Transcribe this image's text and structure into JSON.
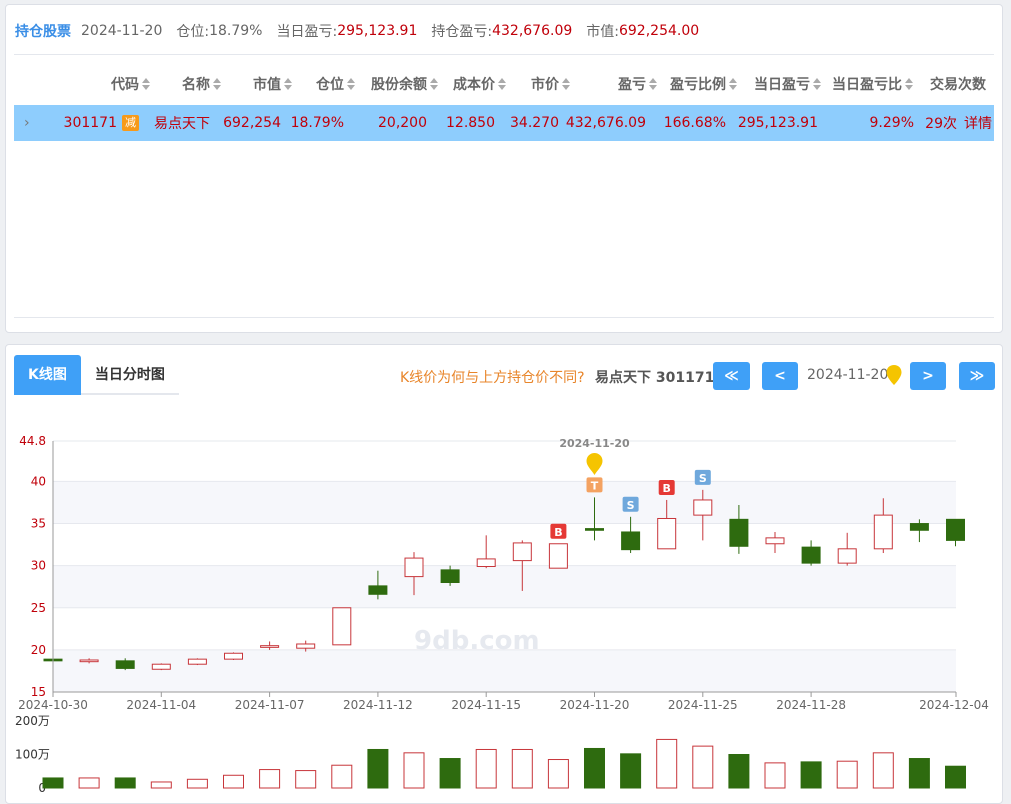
{
  "holdings": {
    "title": "持仓股票",
    "date": "2024-11-20",
    "position_label": "仓位:",
    "position_value": "18.79%",
    "daily_pl_label": "当日盈亏:",
    "daily_pl_value": "295,123.91",
    "hold_pl_label": "持仓盈亏:",
    "hold_pl_value": "432,676.09",
    "mv_label": "市值:",
    "mv_value": "692,254.00",
    "columns": [
      "代码",
      "名称",
      "市值",
      "仓位",
      "股份余额",
      "成本价",
      "市价",
      "盈亏",
      "盈亏比例",
      "当日盈亏",
      "当日盈亏比",
      "交易次数"
    ],
    "row": {
      "code": "301171",
      "badge": "减",
      "name": "易点天下",
      "mv": "692,254",
      "position": "18.79%",
      "shares": "20,200",
      "cost": "12.850",
      "price": "34.270",
      "pl": "432,676.09",
      "pl_ratio": "166.68%",
      "daily_pl": "295,123.91",
      "daily_pl_ratio": "9.29%",
      "trades": "29次",
      "detail": "详情"
    }
  },
  "kline_panel": {
    "tab_kline": "K线图",
    "tab_intraday": "当日分时图",
    "question": "K线价为何与上方持仓价不同?",
    "stock": "易点天下 301171",
    "btn_first": "≪",
    "btn_prev": "<",
    "current_date": "2024-11-20",
    "btn_next": ">",
    "btn_last": "≫",
    "watermark": "9db.com"
  },
  "chart_data": {
    "type": "candlestick",
    "ylim": [
      15,
      44.8
    ],
    "yticks": [
      "44.8",
      "40",
      "35",
      "30",
      "25",
      "20",
      "15"
    ],
    "xtick_labels": [
      "2024-10-30",
      "2024-11-04",
      "2024-11-07",
      "2024-11-12",
      "2024-11-15",
      "2024-11-20",
      "2024-11-25",
      "2024-11-28",
      "2024-12-04"
    ],
    "marker_date": "2024-11-20",
    "candles": [
      {
        "o": 18.7,
        "c": 18.9,
        "h": 19.0,
        "l": 18.5,
        "up": false
      },
      {
        "o": 18.6,
        "c": 18.8,
        "h": 19.0,
        "l": 18.4,
        "up": true
      },
      {
        "o": 18.7,
        "c": 17.8,
        "h": 19.0,
        "l": 17.6,
        "up": false
      },
      {
        "o": 17.7,
        "c": 18.3,
        "h": 18.4,
        "l": 17.6,
        "up": true
      },
      {
        "o": 18.3,
        "c": 18.9,
        "h": 19.0,
        "l": 18.2,
        "up": true
      },
      {
        "o": 18.9,
        "c": 19.6,
        "h": 19.7,
        "l": 18.8,
        "up": true
      },
      {
        "o": 20.3,
        "c": 20.5,
        "h": 21.0,
        "l": 20.0,
        "up": true
      },
      {
        "o": 20.2,
        "c": 20.7,
        "h": 21.1,
        "l": 19.8,
        "up": true
      },
      {
        "o": 20.6,
        "c": 25.0,
        "h": 25.0,
        "l": 20.6,
        "up": true
      },
      {
        "o": 27.6,
        "c": 26.6,
        "h": 29.4,
        "l": 26.0,
        "up": false
      },
      {
        "o": 28.7,
        "c": 30.9,
        "h": 31.6,
        "l": 26.5,
        "up": true
      },
      {
        "o": 29.5,
        "c": 28.0,
        "h": 30.0,
        "l": 27.6,
        "up": false
      },
      {
        "o": 29.9,
        "c": 30.8,
        "h": 33.6,
        "l": 29.7,
        "up": true
      },
      {
        "o": 30.6,
        "c": 32.7,
        "h": 33.0,
        "l": 27.0,
        "up": true
      },
      {
        "o": 29.7,
        "c": 32.6,
        "h": 32.6,
        "l": 29.7,
        "up": true
      },
      {
        "o": 34.4,
        "c": 34.2,
        "h": 38.1,
        "l": 33.0,
        "up": false
      },
      {
        "o": 34.0,
        "c": 31.9,
        "h": 35.8,
        "l": 31.5,
        "up": false
      },
      {
        "o": 32.0,
        "c": 35.6,
        "h": 37.8,
        "l": 32.0,
        "up": true
      },
      {
        "o": 36.0,
        "c": 37.8,
        "h": 39.0,
        "l": 33.0,
        "up": true
      },
      {
        "o": 35.5,
        "c": 32.3,
        "h": 37.2,
        "l": 31.4,
        "up": false
      },
      {
        "o": 32.6,
        "c": 33.3,
        "h": 34.0,
        "l": 31.5,
        "up": true
      },
      {
        "o": 32.2,
        "c": 30.3,
        "h": 33.0,
        "l": 30.0,
        "up": false
      },
      {
        "o": 30.3,
        "c": 32.0,
        "h": 33.9,
        "l": 30.0,
        "up": true
      },
      {
        "o": 32.0,
        "c": 36.0,
        "h": 38.0,
        "l": 31.5,
        "up": true
      },
      {
        "o": 35.0,
        "c": 34.2,
        "h": 35.5,
        "l": 32.8,
        "up": false
      },
      {
        "o": 35.5,
        "c": 33.0,
        "h": 35.5,
        "l": 32.3,
        "up": false
      }
    ],
    "trade_marks": [
      {
        "index": 14,
        "label": "B",
        "color": "#e53935"
      },
      {
        "index": 15,
        "label": "T",
        "color": "#f4a261"
      },
      {
        "index": 16,
        "label": "S",
        "color": "#6fa8dc"
      },
      {
        "index": 17,
        "label": "B",
        "color": "#e53935"
      },
      {
        "index": 18,
        "label": "S",
        "color": "#6fa8dc"
      }
    ],
    "volume": {
      "ylabels": [
        "200万",
        "100万",
        "0"
      ],
      "ymax": 200,
      "values": [
        30,
        30,
        30,
        18,
        26,
        38,
        55,
        52,
        68,
        115,
        105,
        88,
        115,
        115,
        85,
        118,
        102,
        145,
        125,
        100,
        75,
        78,
        80,
        105,
        88,
        65
      ]
    }
  }
}
